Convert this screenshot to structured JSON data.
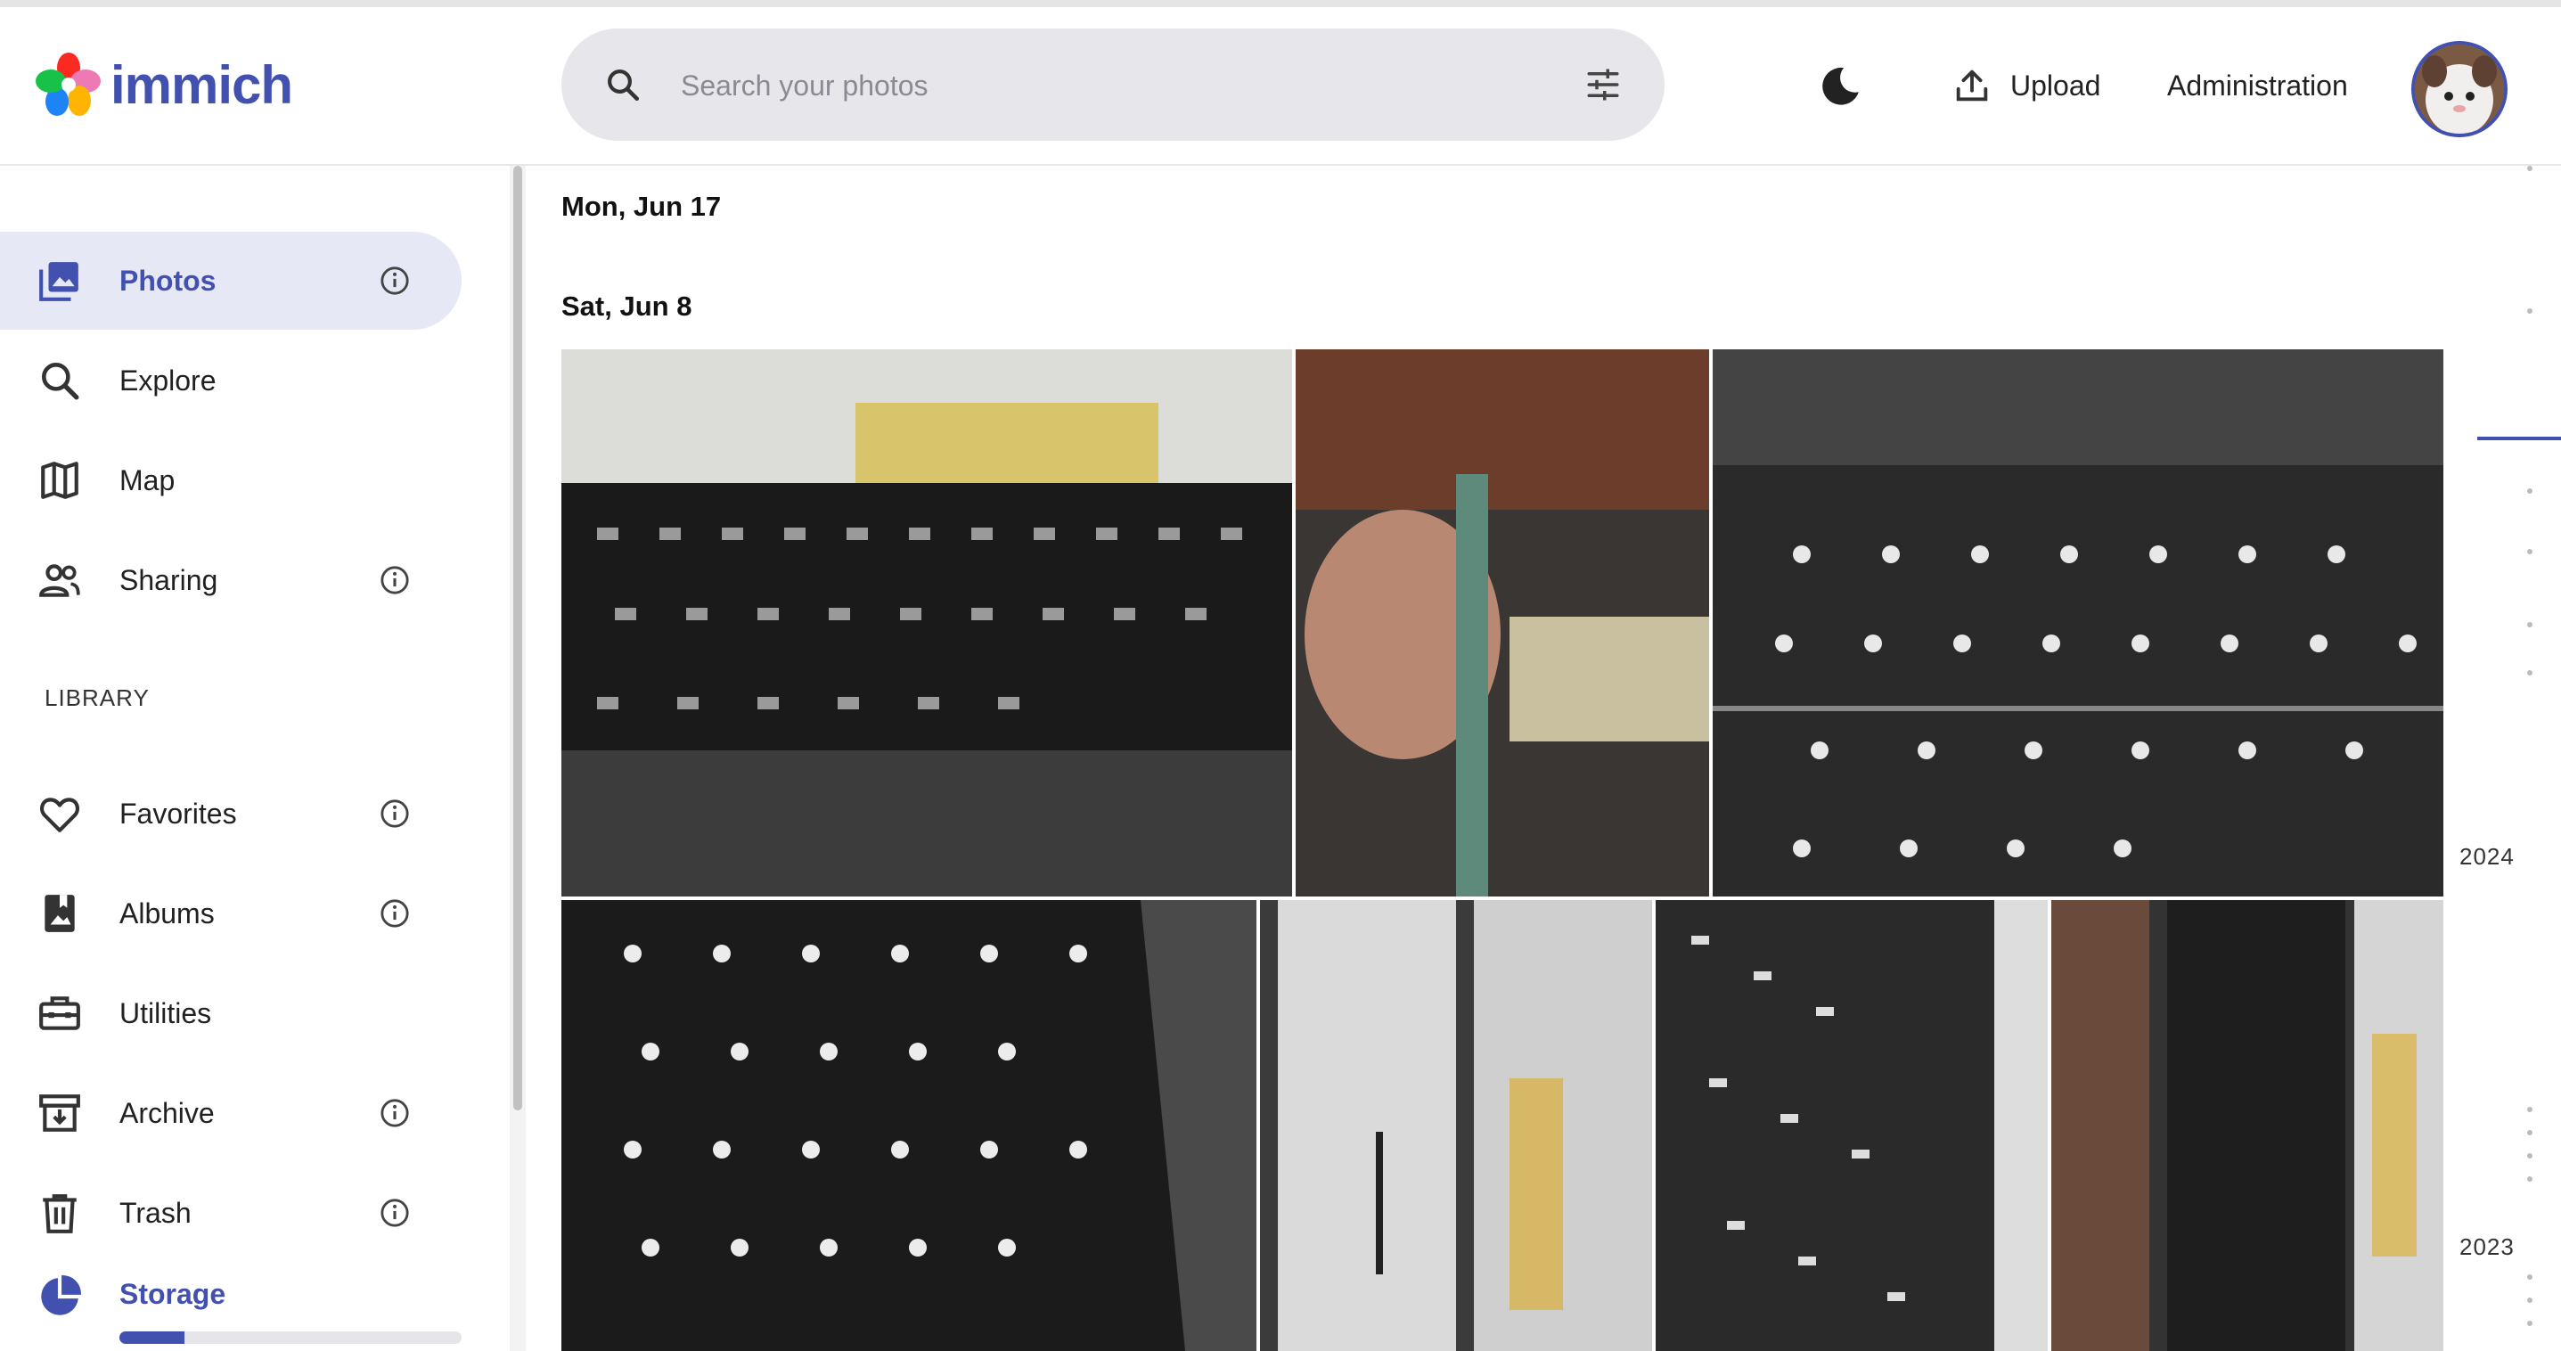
{
  "app": {
    "name": "immich"
  },
  "header": {
    "search_placeholder": "Search your photos",
    "upload_label": "Upload",
    "admin_label": "Administration"
  },
  "sidebar": {
    "items": [
      {
        "label": "Photos",
        "icon": "photos-icon",
        "active": true,
        "info": true
      },
      {
        "label": "Explore",
        "icon": "explore-icon",
        "info": false
      },
      {
        "label": "Map",
        "icon": "map-icon",
        "info": false
      },
      {
        "label": "Sharing",
        "icon": "sharing-icon",
        "info": true
      }
    ],
    "library_title": "LIBRARY",
    "library_items": [
      {
        "label": "Favorites",
        "icon": "heart-icon",
        "info": true
      },
      {
        "label": "Albums",
        "icon": "albums-icon",
        "info": true
      },
      {
        "label": "Utilities",
        "icon": "utilities-icon",
        "info": false
      },
      {
        "label": "Archive",
        "icon": "archive-icon",
        "info": true
      },
      {
        "label": "Trash",
        "icon": "trash-icon",
        "info": true
      }
    ],
    "storage_label": "Storage",
    "storage_used_fraction": 0.19
  },
  "timeline": {
    "groups": [
      {
        "date": "Mon, Jun 17"
      },
      {
        "date": "Sat, Jun 8"
      }
    ]
  },
  "scrubber": {
    "years": [
      "2024",
      "2023"
    ]
  },
  "colors": {
    "accent": "#4250af",
    "active_bg": "#e6e8f6",
    "search_bg": "#e7e7eb"
  }
}
